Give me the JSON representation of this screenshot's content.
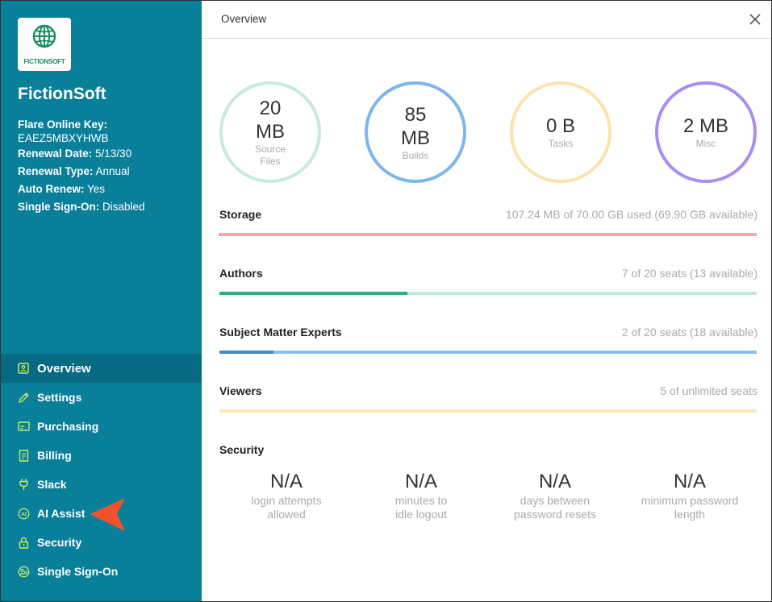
{
  "sidebar": {
    "logo_text": "FICTIONSOFT",
    "company": "FictionSoft",
    "info": {
      "key_label": "Flare Online Key:",
      "key_value": "EAEZ5MBXYHWB",
      "renewal_date_label": "Renewal Date:",
      "renewal_date_value": " 5/13/30",
      "renewal_type_label": "Renewal Type:",
      "renewal_type_value": " Annual",
      "auto_renew_label": "Auto Renew:",
      "auto_renew_value": " Yes",
      "sso_label": "Single Sign-On:",
      "sso_value": " Disabled"
    },
    "nav": [
      {
        "label": "Overview",
        "icon": "overview-icon",
        "active": true
      },
      {
        "label": "Settings",
        "icon": "pencil-icon"
      },
      {
        "label": "Purchasing",
        "icon": "card-icon"
      },
      {
        "label": "Billing",
        "icon": "receipt-icon"
      },
      {
        "label": "Slack",
        "icon": "plug-icon"
      },
      {
        "label": "AI Assist",
        "icon": "ai-icon"
      },
      {
        "label": "Security",
        "icon": "lock-icon"
      },
      {
        "label": "Single Sign-On",
        "icon": "sso-icon"
      }
    ]
  },
  "main": {
    "tab": "Overview",
    "circles": [
      {
        "value": "20 MB",
        "value_l1": "20",
        "value_l2": "MB",
        "label_l1": "Source",
        "label_l2": "Files",
        "color": "#c5ebe0"
      },
      {
        "value": "85 MB",
        "value_l1": "85",
        "value_l2": "MB",
        "label_l1": "Builds",
        "color": "#7db5ee"
      },
      {
        "value": "0 B",
        "label_l1": "Tasks",
        "color": "#fde2ae"
      },
      {
        "value": "2 MB",
        "label_l1": "Misc",
        "color": "#a98df0"
      }
    ],
    "rows": [
      {
        "title": "Storage",
        "info": "107.24 MB of 70.00 GB used (69.90 GB available)",
        "fill_fraction": 0.0015,
        "fill_color": "#e06060",
        "track_color": "#f2aaaa"
      },
      {
        "title": "Authors",
        "info": "7 of 20 seats (13 available)",
        "fill_fraction": 0.35,
        "fill_color": "#22b27d",
        "track_color": "#bfe9dc"
      },
      {
        "title": "Subject Matter Experts",
        "info": "2 of 20 seats (18 available)",
        "fill_fraction": 0.1,
        "fill_color": "#3d8bc9",
        "track_color": "#86bff0"
      },
      {
        "title": "Viewers",
        "info": "5 of unlimited seats",
        "fill_fraction": 0,
        "fill_color": "#fde2ae",
        "track_color": "#fde6b8"
      }
    ],
    "security": {
      "title": "Security",
      "items": [
        {
          "value": "N/A",
          "label_l1": "login attempts",
          "label_l2": "allowed"
        },
        {
          "value": "N/A",
          "label_l1": "minutes to",
          "label_l2": "idle logout"
        },
        {
          "value": "N/A",
          "label_l1": "days between",
          "label_l2": "password resets"
        },
        {
          "value": "N/A",
          "label_l1": "minimum password",
          "label_l2": "length"
        }
      ]
    }
  },
  "colors": {
    "sidebar_bg": "#0a7f9a",
    "nav_active_bg": "#076a82",
    "icon_accent": "#c8e86b",
    "pointer": "#f0522b"
  }
}
